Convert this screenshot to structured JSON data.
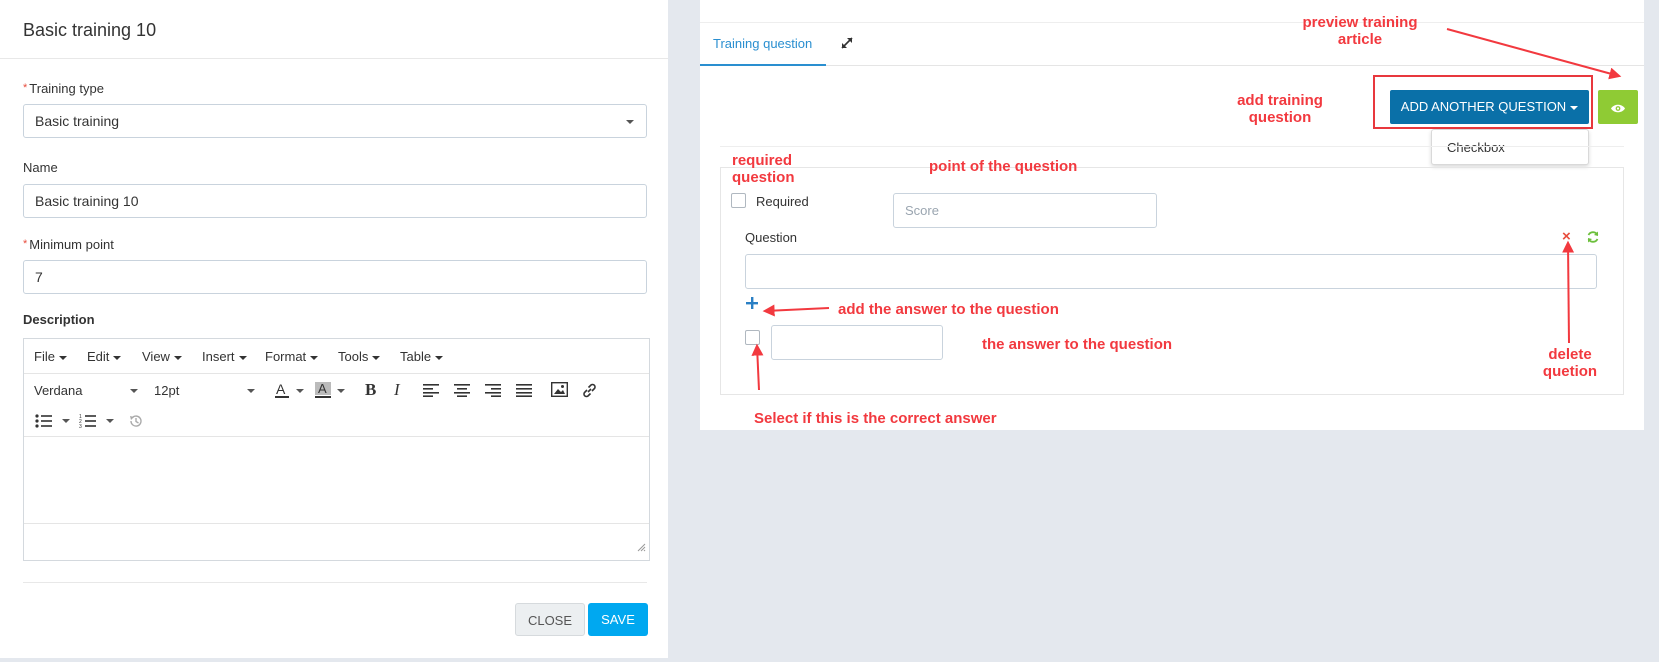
{
  "left": {
    "title": "Basic training 10",
    "training_type": {
      "label": "Training type",
      "value": "Basic training"
    },
    "name": {
      "label": "Name",
      "value": "Basic training 10"
    },
    "min_point": {
      "label": "Minimum point",
      "value": "7"
    },
    "description_label": "Description",
    "editor": {
      "menus": [
        "File",
        "Edit",
        "View",
        "Insert",
        "Format",
        "Tools",
        "Table"
      ],
      "font_family": "Verdana",
      "font_size": "12pt"
    },
    "close_label": "CLOSE",
    "save_label": "SAVE"
  },
  "right": {
    "tab_label": "Training question",
    "add_button_label": "ADD ANOTHER QUESTION",
    "dropdown_option": "Checkbox",
    "required_label": "Required",
    "score_placeholder": "Score",
    "question_label": "Question"
  },
  "annotations": {
    "preview_line1": "preview training",
    "preview_line2": "article",
    "add_q_line1": "add training",
    "add_q_line2": "question",
    "required_line1": "required",
    "required_line2": "question",
    "point": "point of the question",
    "add_answer": "add the answer to the question",
    "answer": "the answer to the question",
    "delete_line1": "delete",
    "delete_line2": "quetion",
    "correct": "Select if this is the correct answer"
  },
  "colors": {
    "accent_blue": "#0a70a8",
    "save_blue": "#00a8f0",
    "preview_green": "#8fcb34",
    "annotation_red": "#f2393f",
    "delete_red": "#e74c3c",
    "refresh_green": "#6cbf3c"
  },
  "icons": [
    "expand-icon",
    "eye-icon",
    "plus-icon",
    "delete-x-icon",
    "refresh-icon",
    "bold-icon",
    "italic-icon",
    "align-left-icon",
    "align-center-icon",
    "align-right-icon",
    "justify-icon",
    "image-icon",
    "link-icon",
    "bullet-list-icon",
    "numbered-list-icon",
    "history-icon",
    "text-color-icon",
    "bg-color-icon",
    "resize-handle-icon"
  ]
}
